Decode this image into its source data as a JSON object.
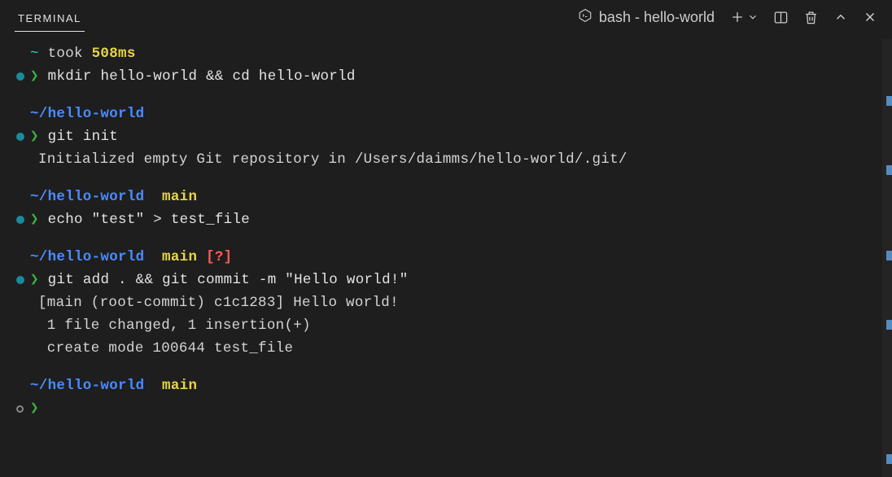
{
  "header": {
    "tab_label": "TERMINAL",
    "shell": "bash - hello-world"
  },
  "term": {
    "l1_tilde": "~",
    "l1_took": " took ",
    "l1_time": "508ms",
    "l2_chev": "❯",
    "l2_cmd": " mkdir hello-world && cd hello-world",
    "l3_path": "~/hello-world",
    "l4_chev": "❯",
    "l4_cmd": " git init",
    "l5_out": "Initialized empty Git repository in /Users/daimms/hello-world/.git/",
    "l6_path": "~/hello-world ",
    "l6_sym": " ",
    "l6_branch": "main",
    "l7_chev": "❯",
    "l7_cmd": " echo \"test\" > test_file",
    "l8_path": "~/hello-world ",
    "l8_sym": " ",
    "l8_branch": "main ",
    "l8_status": "[?]",
    "l9_chev": "❯",
    "l9_cmd": " git add . && git commit -m \"Hello world!\"",
    "l10_out": "[main (root-commit) c1c1283] Hello world!",
    "l11_out": " 1 file changed, 1 insertion(+)",
    "l12_out": " create mode 100644 test_file",
    "l13_path": "~/hello-world ",
    "l13_sym": " ",
    "l13_branch": "main",
    "l14_chev": "❯"
  }
}
